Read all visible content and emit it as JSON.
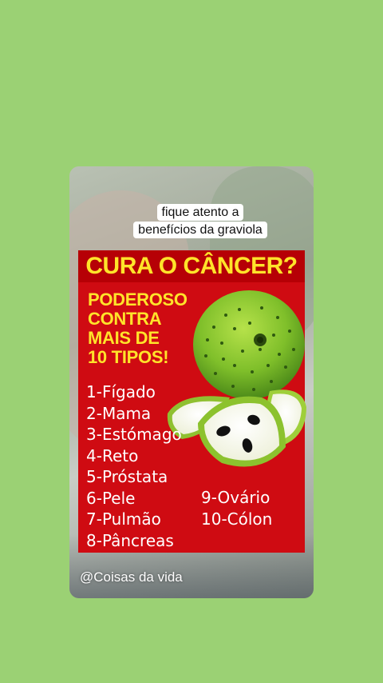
{
  "caption": {
    "line1": "fique atento a",
    "line2": "benefícios da graviola"
  },
  "poster": {
    "headline": "CURA O CÂNCER?",
    "tagline": [
      "PODEROSO",
      "CONTRA",
      "MAIS DE",
      "10 TIPOS!"
    ],
    "organs": [
      "1-Fígado",
      "2-Mama",
      "3-Estómago",
      "4-Reto",
      "5-Próstata",
      "6-Pele",
      "7-Pulmão",
      "8-Pâncreas"
    ],
    "organs_right": [
      "9-Ovário",
      "10-Cólon"
    ],
    "colors": {
      "background": "#cf0b12",
      "headline_bar": "#b60006",
      "accent_yellow": "#ffe42a"
    }
  },
  "watermark": "@Coisas da vida",
  "page": {
    "background": "#9bd174"
  }
}
